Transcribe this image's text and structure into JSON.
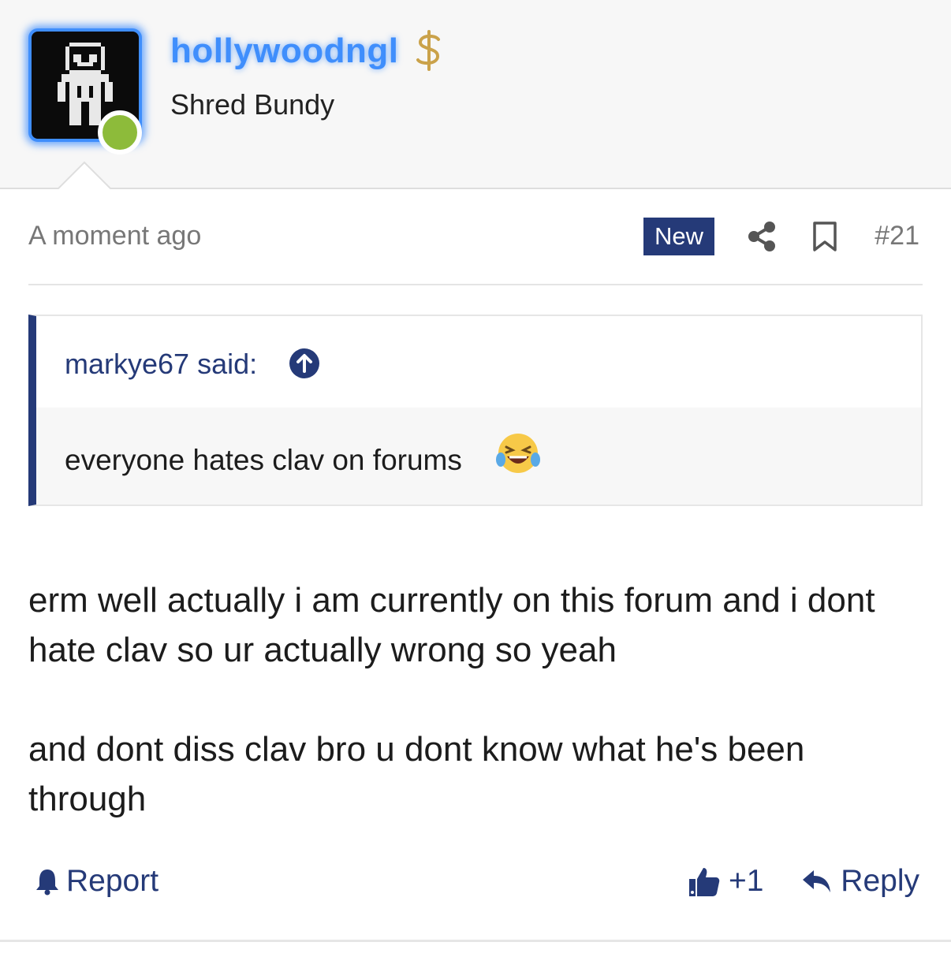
{
  "user": {
    "name": "hollywoodngl",
    "title": "Shred Bundy",
    "avatar": "pixel-figure-avatar",
    "status": "online",
    "badge_icon": "dollar-icon"
  },
  "meta": {
    "timestamp": "A moment ago",
    "new_label": "New",
    "post_number": "#21"
  },
  "quote": {
    "author": "markye67 said:",
    "text": "everyone hates clav on forums",
    "emoji": "crying-laughing-emoji"
  },
  "body": {
    "paragraph1": "erm well actually i am currently on this forum and i dont hate clav so ur actually wrong so yeah",
    "paragraph2": "and dont diss clav bro u dont know what he's been through"
  },
  "actions": {
    "report_label": "Report",
    "like_count": "+1",
    "reply_label": "Reply"
  },
  "colors": {
    "accent": "#253a78",
    "username": "#3f8efc",
    "online": "#8dbb3a"
  }
}
